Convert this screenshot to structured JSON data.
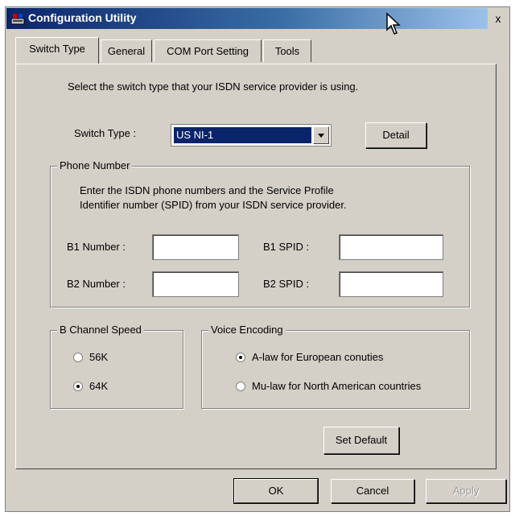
{
  "window": {
    "title": "Configuration Utility",
    "close_glyph": "x"
  },
  "tabs": [
    {
      "label": "Switch Type",
      "active": true
    },
    {
      "label": "General"
    },
    {
      "label": "COM Port Setting"
    },
    {
      "label": "Tools"
    }
  ],
  "switch_tab": {
    "instruction": "Select the switch type that your ISDN service provider is using.",
    "switch_type_label": "Switch Type :",
    "switch_type_value": "US NI-1",
    "detail_button": "Detail",
    "phone_group": {
      "title": "Phone Number",
      "desc_line1": "Enter the ISDN phone numbers and the Service Profile",
      "desc_line2": "Identifier number (SPID) from your ISDN service provider.",
      "b1_number_label": "B1 Number :",
      "b2_number_label": "B2 Number :",
      "b1_spid_label": "B1 SPID :",
      "b2_spid_label": "B2 SPID :",
      "b1_number_value": "",
      "b2_number_value": "",
      "b1_spid_value": "",
      "b2_spid_value": ""
    },
    "speed_group": {
      "title": "B Channel Speed",
      "options": [
        {
          "label": "56K",
          "selected": false
        },
        {
          "label": "64K",
          "selected": true
        }
      ]
    },
    "voice_group": {
      "title": "Voice Encoding",
      "options": [
        {
          "label": "A-law for European conuties",
          "selected": true
        },
        {
          "label": "Mu-law for North American countries",
          "selected": false
        }
      ]
    },
    "set_default_button": "Set Default"
  },
  "footer": {
    "ok": "OK",
    "cancel": "Cancel",
    "apply": "Apply"
  },
  "colors": {
    "titlebar_start": "#0a246a",
    "titlebar_end": "#a6caf0",
    "face": "#d4d0c8",
    "selection": "#0a246a"
  }
}
